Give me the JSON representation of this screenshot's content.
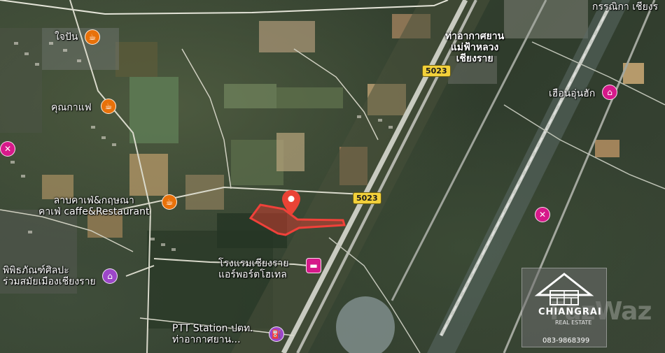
{
  "map": {
    "type": "satellite",
    "markers": [
      {
        "id": "jaipan",
        "label": "ใจปัน",
        "category": "cafe",
        "icon": "coffee-icon",
        "color": "#e8710a"
      },
      {
        "id": "khun-kafae",
        "label": "คุณกาแฟ",
        "category": "cafe",
        "icon": "coffee-icon",
        "color": "#e8710a"
      },
      {
        "id": "lap-cafe",
        "label_lines": [
          "ลาบคาเฟ่&กฤษณา",
          "คาเฟ่ caffe&Restaurant"
        ],
        "category": "cafe",
        "icon": "coffee-icon",
        "color": "#e8710a"
      },
      {
        "id": "airport",
        "label_lines": [
          "ท่าอากาศยาน",
          "แม่ฟ้าหลวง",
          "เชียงราย"
        ],
        "category": "airport"
      },
      {
        "id": "hueanunhak",
        "label": "เฮือนอุ่นฮัก",
        "category": "hotel",
        "icon": "hotel-icon",
        "color": "#d6198a"
      },
      {
        "id": "museum",
        "label_lines": [
          "พิพิธภัณฑ์ศิลปะ",
          "ร่วมสมัยเมืองเชียงราย"
        ],
        "category": "museum",
        "icon": "museum-icon",
        "color": "#9c46c9"
      },
      {
        "id": "hotel",
        "label_lines": [
          "โรงแรมเชียงราย",
          "แอร์พอร์ตโฮเทล"
        ],
        "category": "hotel",
        "icon": "bed-icon",
        "color": "#d6198a"
      },
      {
        "id": "ptt",
        "label_lines": [
          "PTT Station ปตท.",
          "ท่าอากาศยาน..."
        ],
        "category": "gas",
        "icon": "fuel-icon",
        "color": "#9c46c9"
      },
      {
        "id": "top-right",
        "label": "กรรณิกา เชียงร",
        "category": "place"
      },
      {
        "id": "left-pink",
        "category": "place",
        "icon": "tools-icon",
        "color": "#d6198a"
      },
      {
        "id": "right-pink",
        "category": "place",
        "icon": "tools-icon",
        "color": "#d6198a"
      }
    ],
    "roads": [
      {
        "id": "road-north",
        "number": "5023"
      },
      {
        "id": "road-south",
        "number": "5023"
      }
    ],
    "highlight": {
      "color": "#e8312a",
      "description_marker": "location-pin"
    }
  },
  "watermark": {
    "brand": "FazWaz",
    "agent_name": "CHIANGRAI",
    "agent_tagline": "REAL ESTATE",
    "phone": "083-9868399"
  }
}
